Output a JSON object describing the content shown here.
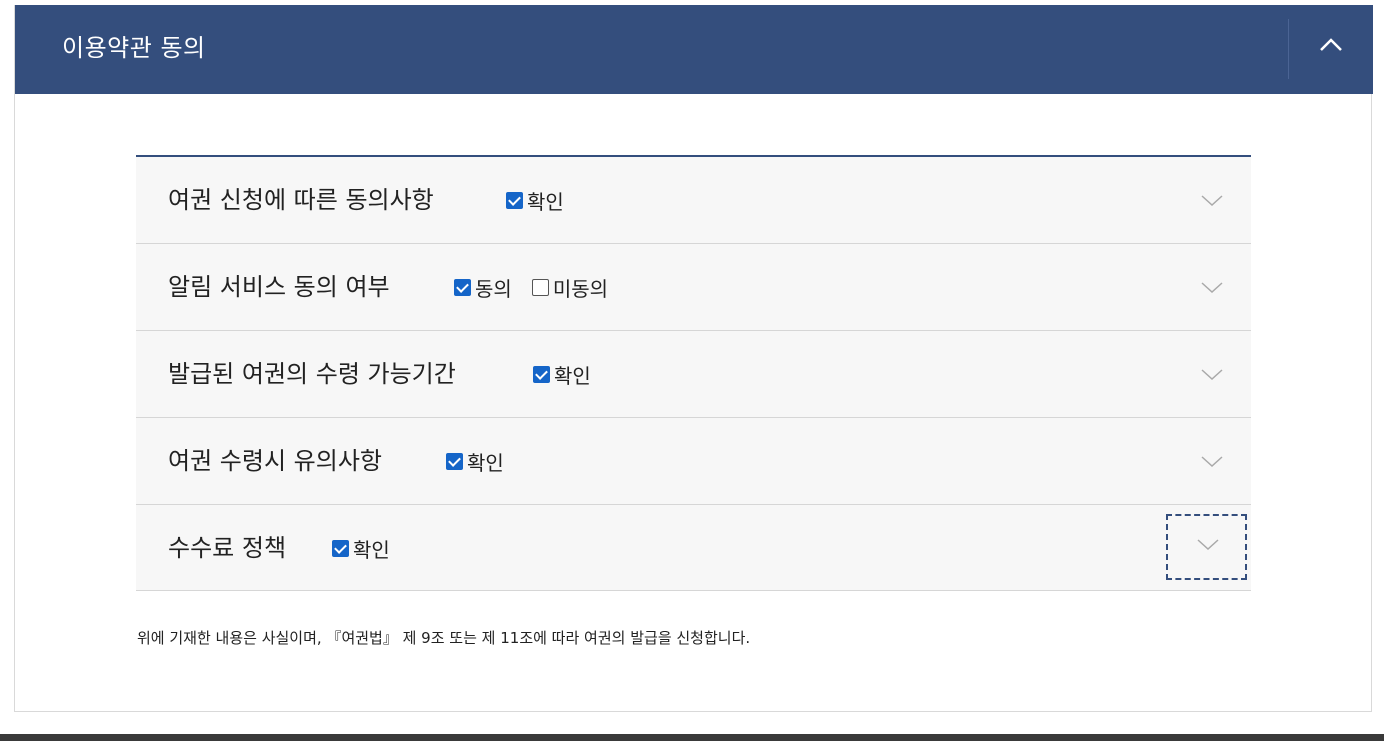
{
  "panel": {
    "title": "이용약관 동의",
    "collapse_icon": "chevron-up-icon"
  },
  "agreements": [
    {
      "title": "여권 신청에 따른 동의사항",
      "options": [
        {
          "label": "확인",
          "checked": true
        }
      ]
    },
    {
      "title": "알림 서비스 동의 여부",
      "options": [
        {
          "label": "동의",
          "checked": true
        },
        {
          "label": "미동의",
          "checked": false
        }
      ]
    },
    {
      "title": "발급된 여권의 수령 가능기간",
      "options": [
        {
          "label": "확인",
          "checked": true
        }
      ]
    },
    {
      "title": "여권 수령시 유의사항",
      "options": [
        {
          "label": "확인",
          "checked": true
        }
      ]
    },
    {
      "title": "수수료 정책",
      "options": [
        {
          "label": "확인",
          "checked": true
        }
      ]
    }
  ],
  "declaration": "위에 기재한 내용은 사실이며, 『여권법』 제 9조 또는 제 11조에 따라 여권의 발급을 신청합니다.",
  "colors": {
    "header_bg": "#344e7d",
    "checkbox": "#1565c8",
    "row_bg": "#f7f7f7"
  }
}
